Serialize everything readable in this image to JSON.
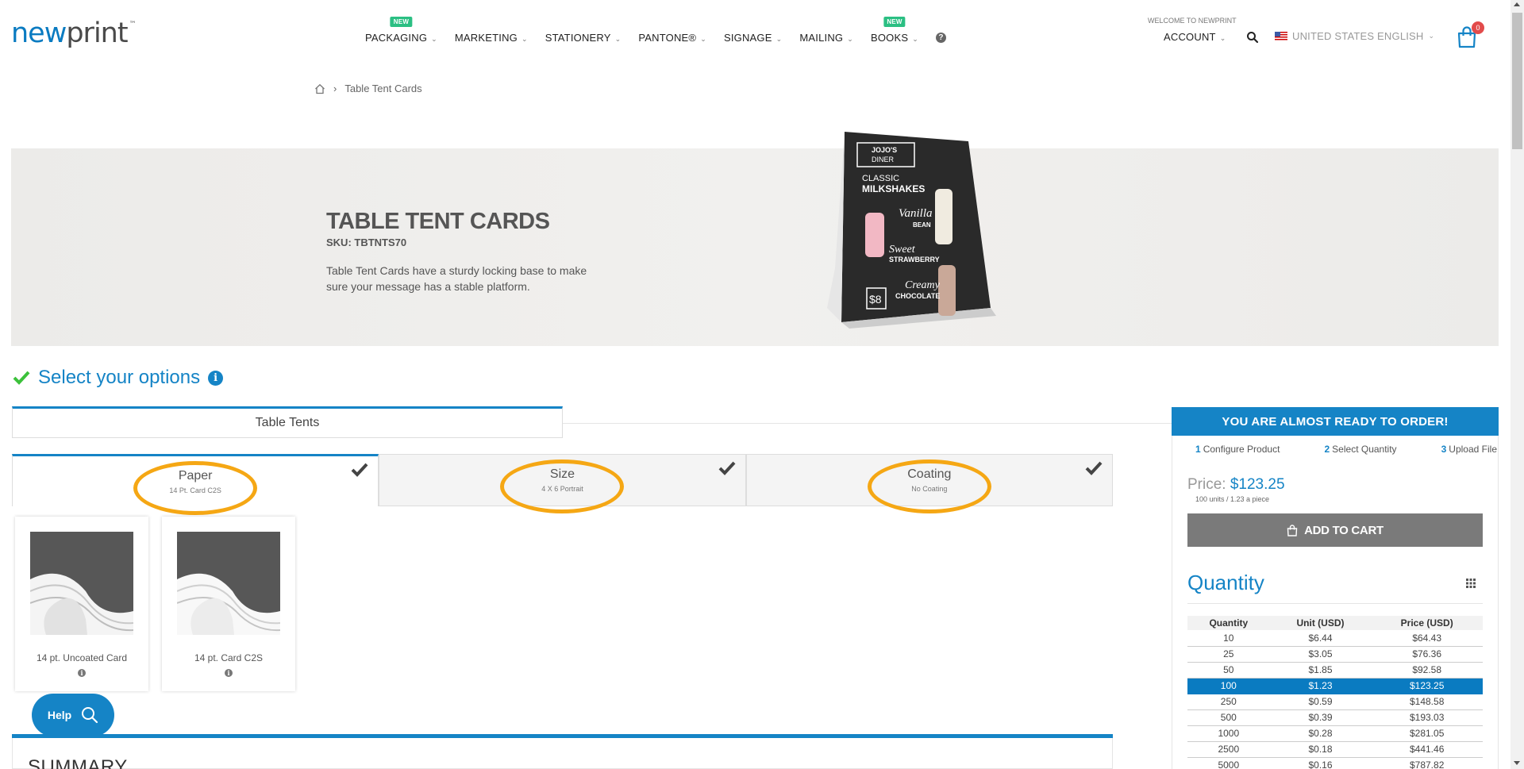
{
  "brand": {
    "logo_new": "new",
    "logo_print": "print",
    "tm": "™"
  },
  "nav": {
    "items": [
      {
        "label": "PACKAGING",
        "badge": "NEW"
      },
      {
        "label": "MARKETING",
        "badge": ""
      },
      {
        "label": "STATIONERY",
        "badge": ""
      },
      {
        "label": "PANTONE®",
        "badge": ""
      },
      {
        "label": "SIGNAGE",
        "badge": ""
      },
      {
        "label": "MAILING",
        "badge": ""
      },
      {
        "label": "BOOKS",
        "badge": "NEW"
      }
    ],
    "help": "?"
  },
  "account": {
    "welcome": "WELCOME TO NEWPRINT",
    "label": "ACCOUNT"
  },
  "language": {
    "label": "UNITED STATES ENGLISH"
  },
  "cart": {
    "count": "0"
  },
  "breadcrumb": {
    "current": "Table Tent Cards"
  },
  "hero": {
    "title": "TABLE TENT CARDS",
    "sku": "SKU: TBTNTS70",
    "description": "Table Tent Cards have a sturdy locking base to make sure your message has a stable platform.",
    "tent": {
      "logo1": "JOJO'S",
      "logo2": "DINER",
      "line1": "CLASSIC",
      "line2": "MILKSHAKES",
      "vanilla1": "Vanilla",
      "vanilla2": "BEAN",
      "straw1": "Sweet",
      "straw2": "STRAWBERRY",
      "choc1": "Creamy",
      "choc2": "CHOCOLATE",
      "price": "$8"
    }
  },
  "options": {
    "title": "Select your options",
    "product_tab": "Table Tents",
    "tabs": [
      {
        "title": "Paper",
        "sub": "14 Pt. Card C2S"
      },
      {
        "title": "Size",
        "sub": "4 X 6 Portrait"
      },
      {
        "title": "Coating",
        "sub": "No Coating"
      }
    ],
    "papers": [
      {
        "name": "14 pt. Uncoated Card"
      },
      {
        "name": "14 pt. Card C2S"
      }
    ]
  },
  "help_button": {
    "label": "Help"
  },
  "summary": {
    "title": "SUMMARY"
  },
  "order": {
    "header": "YOU ARE ALMOST READY TO ORDER!",
    "steps": [
      {
        "num": "1",
        "label": "Configure Product"
      },
      {
        "num": "2",
        "label": "Select Quantity"
      },
      {
        "num": "3",
        "label": "Upload File"
      }
    ],
    "price_label": "Price:",
    "price_value": "$123.25",
    "price_sub": "100 units / 1.23 a piece",
    "add_to_cart": "ADD TO CART",
    "quantity_title": "Quantity",
    "table_headers": [
      "Quantity",
      "Unit (USD)",
      "Price (USD)"
    ],
    "rows": [
      {
        "qty": "10",
        "unit": "$6.44",
        "price": "$64.43"
      },
      {
        "qty": "25",
        "unit": "$3.05",
        "price": "$76.36"
      },
      {
        "qty": "50",
        "unit": "$1.85",
        "price": "$92.58"
      },
      {
        "qty": "100",
        "unit": "$1.23",
        "price": "$123.25"
      },
      {
        "qty": "250",
        "unit": "$0.59",
        "price": "$148.58"
      },
      {
        "qty": "500",
        "unit": "$0.39",
        "price": "$193.03"
      },
      {
        "qty": "1000",
        "unit": "$0.28",
        "price": "$281.05"
      },
      {
        "qty": "2500",
        "unit": "$0.18",
        "price": "$441.46"
      },
      {
        "qty": "5000",
        "unit": "$0.16",
        "price": "$787.82"
      }
    ],
    "selected_row": 3
  },
  "colors": {
    "accent": "#1584c6",
    "highlight": "#f5a714",
    "new_badge": "#2bbf83"
  }
}
